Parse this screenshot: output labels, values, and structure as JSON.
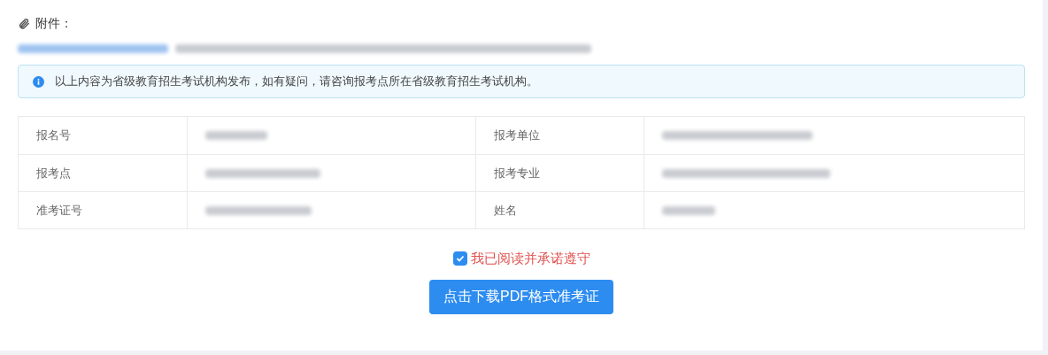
{
  "attachments": {
    "label": "附件："
  },
  "notice": {
    "text": "以上内容为省级教育招生考试机构发布，如有疑问，请咨询报考点所在省级教育招生考试机构。"
  },
  "info_table": {
    "rows": [
      {
        "cells": [
          {
            "label": "报名号"
          },
          {
            "label": "报考单位"
          }
        ]
      },
      {
        "cells": [
          {
            "label": "报考点"
          },
          {
            "label": "报考专业"
          }
        ]
      },
      {
        "cells": [
          {
            "label": "准考证号"
          },
          {
            "label": "姓名"
          }
        ]
      }
    ]
  },
  "agreement": {
    "label": "我已阅读并承诺遵守",
    "checked": true
  },
  "download_button": {
    "label": "点击下载PDF格式准考证"
  }
}
